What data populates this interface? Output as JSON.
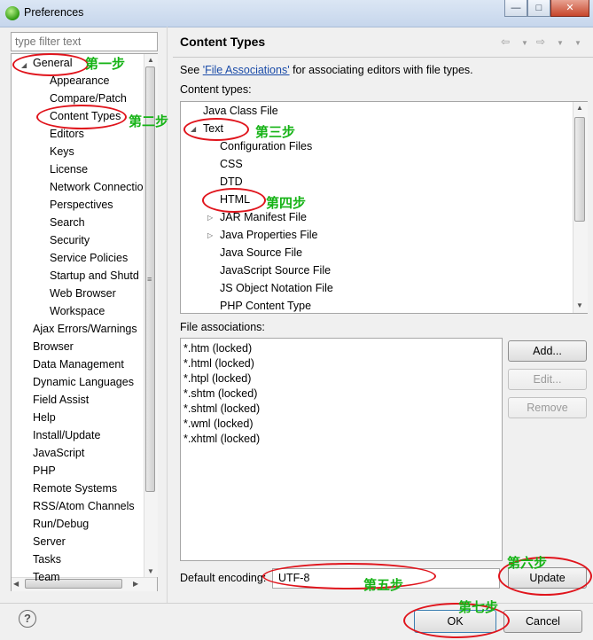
{
  "window": {
    "title": "Preferences"
  },
  "filter": {
    "placeholder": "type filter text"
  },
  "tree": {
    "general": "General",
    "children": [
      "Appearance",
      "Compare/Patch",
      "Content Types",
      "Editors",
      "Keys",
      "License",
      "Network Connectio",
      "Perspectives",
      "Search",
      "Security",
      "Service Policies",
      "Startup and Shutd",
      "Web Browser",
      "Workspace"
    ],
    "top": [
      "Ajax Errors/Warnings",
      "Browser",
      "Data Management",
      "Dynamic Languages",
      "Field Assist",
      "Help",
      "Install/Update",
      "JavaScript",
      "PHP",
      "Remote Systems",
      "RSS/Atom Channels",
      "Run/Debug",
      "Server",
      "Tasks",
      "Team"
    ]
  },
  "page": {
    "title": "Content Types",
    "desc_pre": "See ",
    "desc_link": "'File Associations'",
    "desc_post": " for associating editors with file types.",
    "content_types_label": "Content types:",
    "content_types": [
      "Java Class File",
      "Text",
      "Configuration Files",
      "CSS",
      "DTD",
      "HTML",
      "JAR Manifest File",
      "Java Properties File",
      "Java Source File",
      "JavaScript Source File",
      "JS Object Notation File",
      "PHP Content Type"
    ],
    "file_assoc_label": "File associations:",
    "file_assoc": [
      "*.htm (locked)",
      "*.html (locked)",
      "*.htpl (locked)",
      "*.shtm (locked)",
      "*.shtml (locked)",
      "*.wml (locked)",
      "*.xhtml (locked)"
    ],
    "add_label": "Add...",
    "edit_label": "Edit...",
    "remove_label": "Remove",
    "encoding_label": "Default encoding:",
    "encoding_value": "UTF-8",
    "update_label": "Update"
  },
  "footer": {
    "help": "?",
    "ok_label": "OK",
    "cancel_label": "Cancel"
  },
  "annotations": [
    "第一步",
    "第二步",
    "第三步",
    "第四步",
    "第五步",
    "第六步",
    "第七步"
  ],
  "colors": {
    "annotation": "#16b316",
    "ring": "#e0141c",
    "link": "#1a4ba8"
  }
}
